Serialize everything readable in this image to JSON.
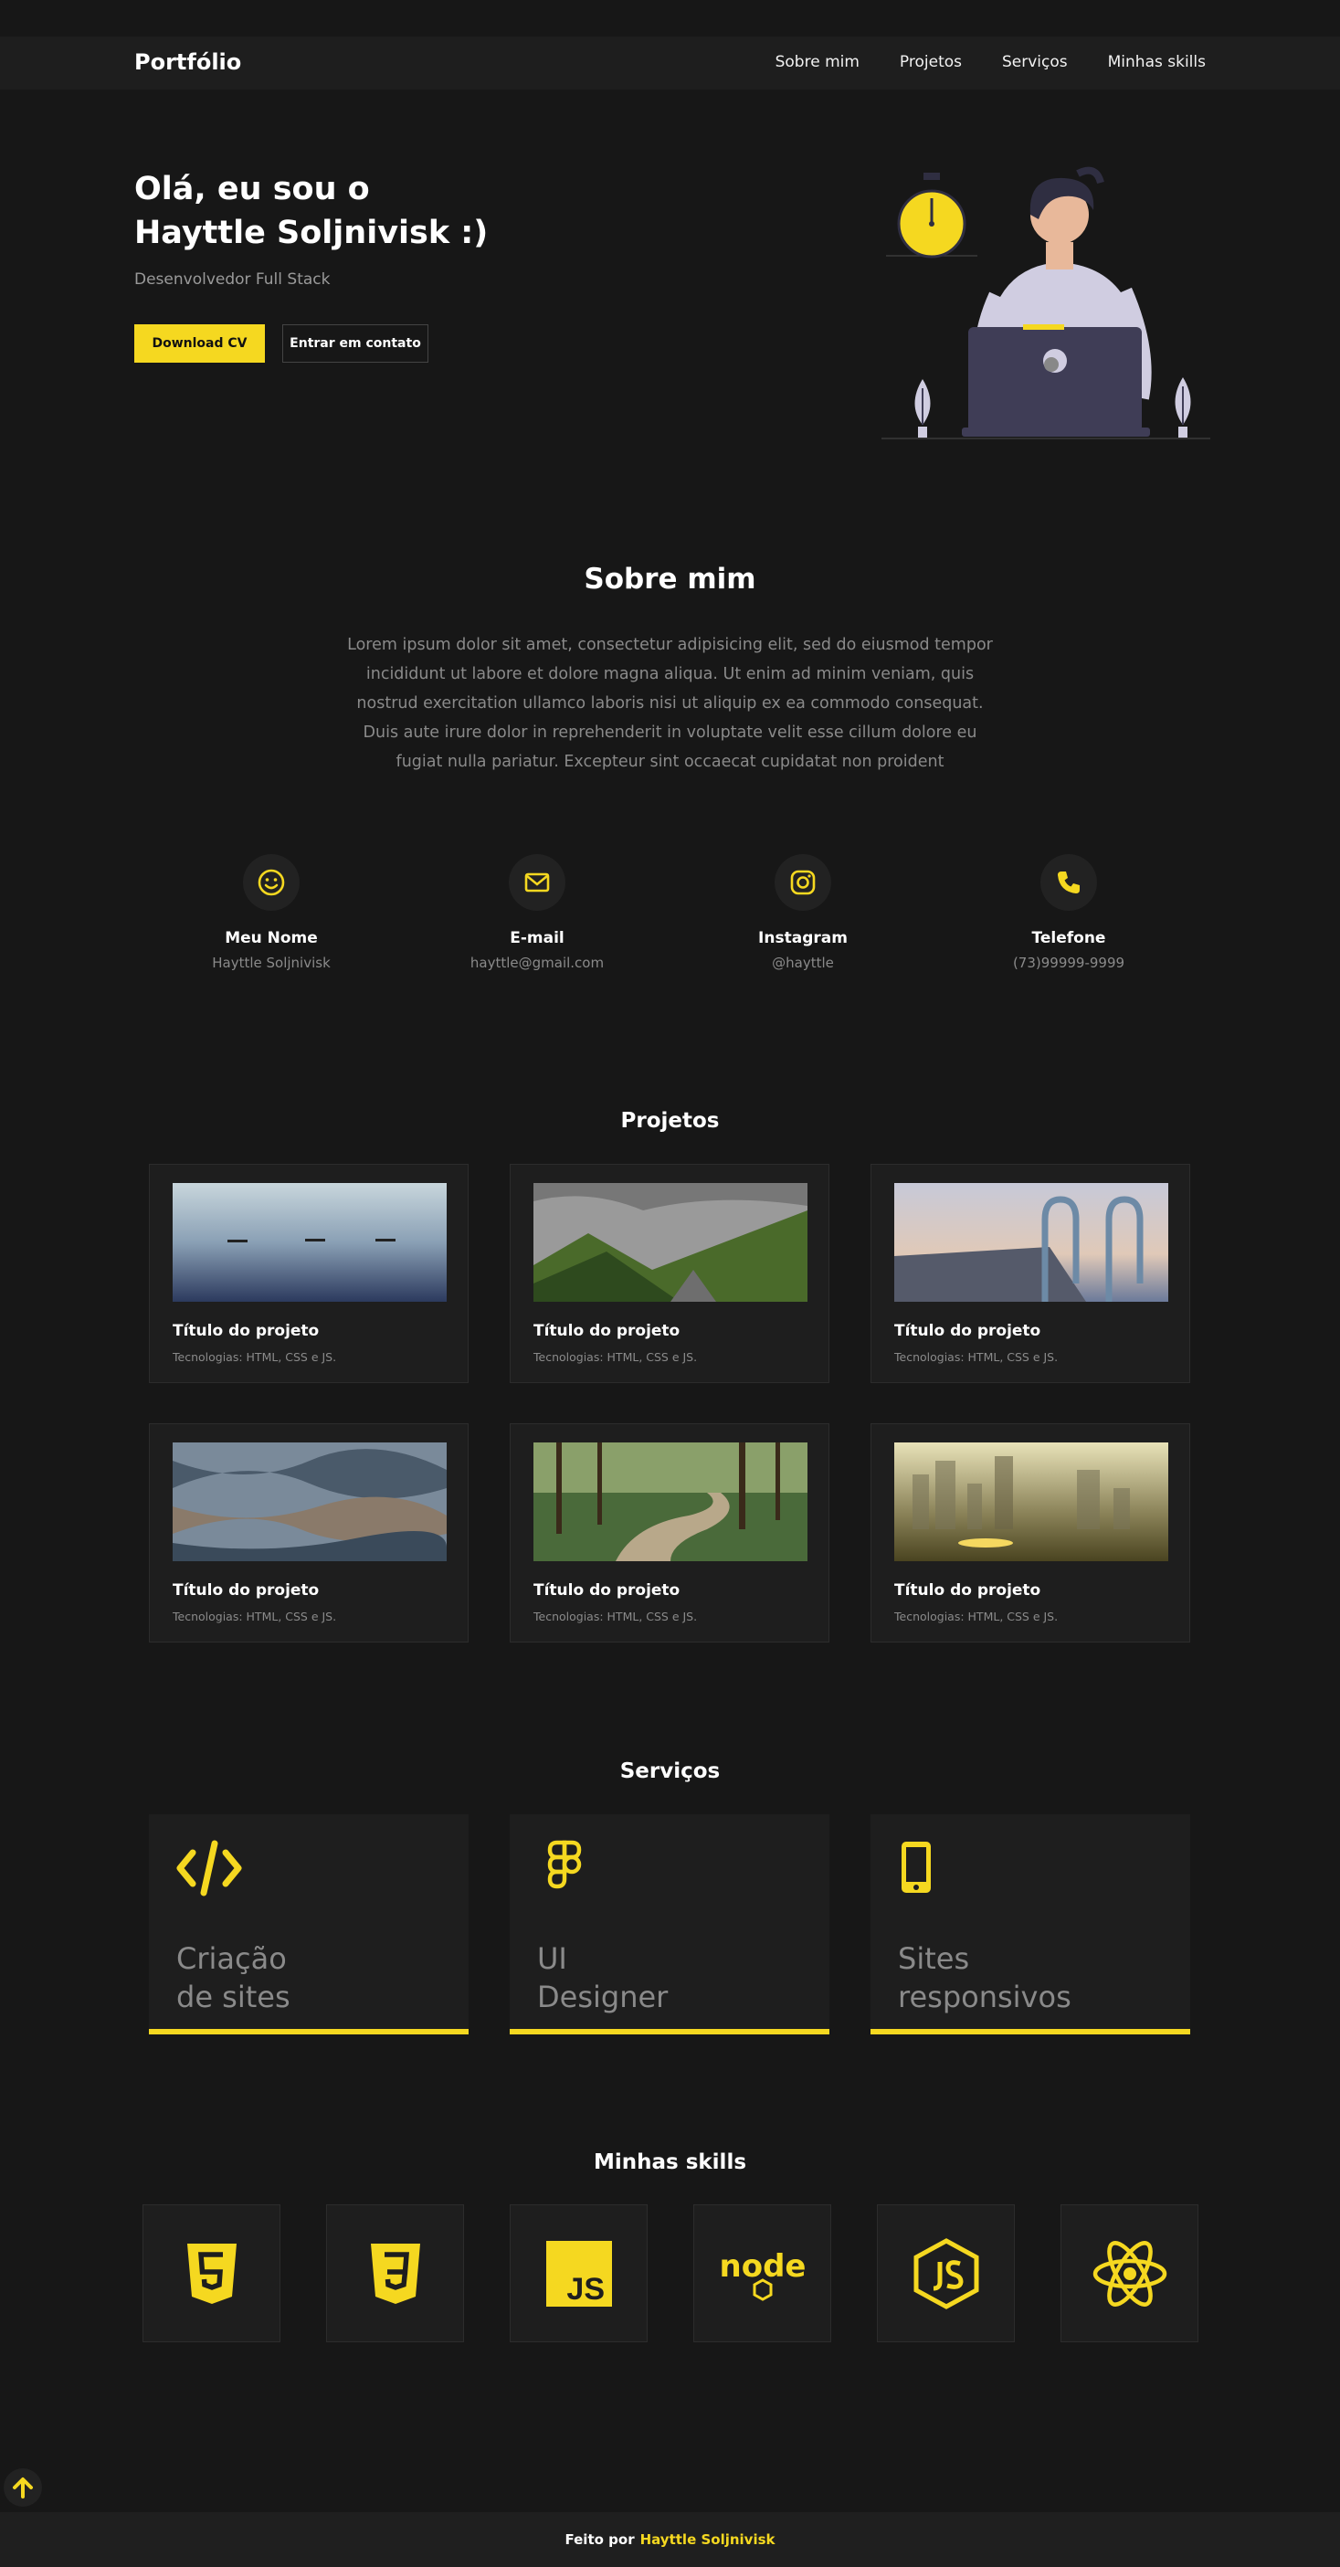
{
  "colors": {
    "accent": "#f5d820",
    "background": "#171717",
    "card": "#1e1e1e",
    "muted": "#8a8a8a"
  },
  "header": {
    "logo": "Portfólio",
    "nav": [
      "Sobre mim",
      "Projetos",
      "Serviços",
      "Minhas skills"
    ]
  },
  "hero": {
    "title_line1": "Olá, eu sou o",
    "title_line2": "Hayttle Soljnivisk :)",
    "subtitle": "Desenvolvedor Full Stack",
    "btn_download": "Download CV",
    "btn_contact": "Entrar em contato"
  },
  "about": {
    "title": "Sobre mim",
    "text": "Lorem ipsum dolor sit amet, consectetur adipisicing elit, sed do eiusmod tempor incididunt ut labore et dolore magna aliqua. Ut enim ad minim veniam, quis nostrud exercitation ullamco laboris nisi ut aliquip ex ea commodo consequat. Duis aute irure dolor in reprehenderit in voluptate velit esse cillum dolore eu fugiat nulla pariatur. Excepteur sint occaecat cupidatat non proident",
    "contacts": [
      {
        "icon": "smile-icon",
        "label": "Meu Nome",
        "value": "Hayttle Soljnivisk"
      },
      {
        "icon": "envelope-icon",
        "label": "E-mail",
        "value": "hayttle@gmail.com"
      },
      {
        "icon": "instagram-icon",
        "label": "Instagram",
        "value": "@hayttle"
      },
      {
        "icon": "phone-icon",
        "label": "Telefone",
        "value": "(73)99999-9999"
      }
    ]
  },
  "projects": {
    "title": "Projetos",
    "items": [
      {
        "title": "Título do projeto",
        "tech": "Tecnologias: HTML, CSS e JS."
      },
      {
        "title": "Título do projeto",
        "tech": "Tecnologias: HTML, CSS e JS."
      },
      {
        "title": "Título do projeto",
        "tech": "Tecnologias: HTML, CSS e JS."
      },
      {
        "title": "Título do projeto",
        "tech": "Tecnologias: HTML, CSS e JS."
      },
      {
        "title": "Título do projeto",
        "tech": "Tecnologias: HTML, CSS e JS."
      },
      {
        "title": "Título do projeto",
        "tech": "Tecnologias: HTML, CSS e JS."
      }
    ]
  },
  "services": {
    "title": "Serviços",
    "items": [
      {
        "icon": "code-icon",
        "line1": "Criação",
        "line2": "de sites"
      },
      {
        "icon": "figma-icon",
        "line1": "UI",
        "line2": "Designer"
      },
      {
        "icon": "mobile-icon",
        "line1": "Sites",
        "line2": "responsivos"
      }
    ]
  },
  "skills": {
    "title": "Minhas skills",
    "items": [
      "html5-icon",
      "css3-icon",
      "javascript-icon",
      "nodejs-icon",
      "nodejs-hex-icon",
      "react-icon"
    ],
    "js_label": "JS",
    "node_label": "node"
  },
  "footer": {
    "prefix": "Feito por",
    "author": "Hayttle Soljnivisk"
  }
}
